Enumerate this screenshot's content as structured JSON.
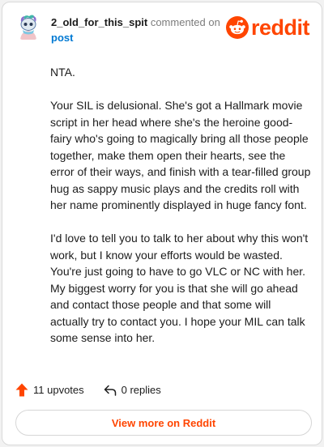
{
  "author": {
    "username": "2_old_for_this_spit",
    "action_text": "commented on",
    "link_text": "post"
  },
  "brand": {
    "wordmark": "reddit",
    "color": "#ff4500"
  },
  "comment": {
    "paragraphs": [
      "NTA.",
      "Your SIL is delusional. She's got a Hallmark movie script in her head where she's the heroine good-fairy who's going to magically bring all those people together, make them open their hearts, see the error of their ways, and finish with a tear-filled group hug as sappy music plays and the credits roll with her name prominently displayed in huge fancy font.",
      "I'd love to tell you to talk to her about why this won't work, but I know your efforts would be wasted. You're just going to have to go VLC or NC with her. My biggest worry for you is that she will go ahead and contact those people and that some will actually try to contact you. I hope your MIL can talk some sense into her."
    ]
  },
  "stats": {
    "upvotes": "11 upvotes",
    "replies": "0 replies",
    "upvote_icon": "upvote-arrow-icon",
    "reply_icon": "reply-arrow-icon"
  },
  "cta": {
    "label": "View more on Reddit"
  }
}
